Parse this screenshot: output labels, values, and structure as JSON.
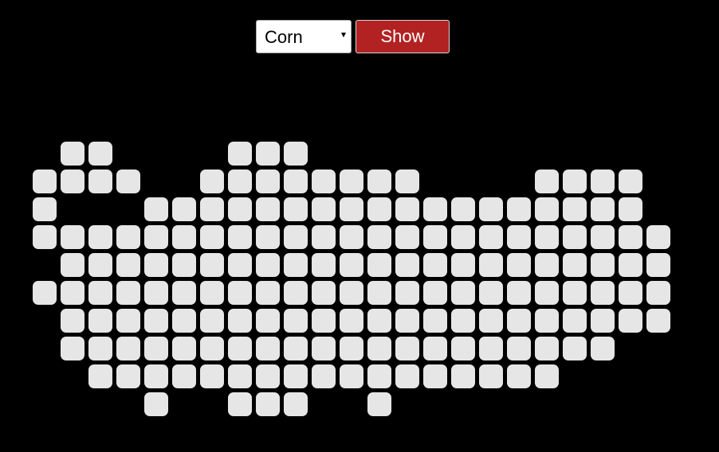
{
  "controls": {
    "crop_select": {
      "selected": "Corn"
    },
    "show_label": "Show"
  },
  "colors": {
    "background": "#000000",
    "tile": "#e6e6e6",
    "button": "#b22222"
  },
  "tile_map": {
    "rows": [
      [
        1,
        2,
        7,
        8,
        9
      ],
      [
        0,
        1,
        2,
        3,
        6,
        7,
        8,
        9,
        10,
        11,
        12,
        13,
        18,
        19,
        20,
        21
      ],
      [
        0,
        4,
        5,
        6,
        7,
        8,
        9,
        10,
        11,
        12,
        13,
        14,
        15,
        16,
        17,
        18,
        19,
        20,
        21
      ],
      [
        0,
        1,
        2,
        3,
        4,
        5,
        6,
        7,
        8,
        9,
        10,
        11,
        12,
        13,
        14,
        15,
        16,
        17,
        18,
        19,
        20,
        21,
        22
      ],
      [
        1,
        2,
        3,
        4,
        5,
        6,
        7,
        8,
        9,
        10,
        11,
        12,
        13,
        14,
        15,
        16,
        17,
        18,
        19,
        20,
        21,
        22
      ],
      [
        0,
        1,
        2,
        3,
        4,
        5,
        6,
        7,
        8,
        9,
        10,
        11,
        12,
        13,
        14,
        15,
        16,
        17,
        18,
        19,
        20,
        21,
        22
      ],
      [
        1,
        2,
        3,
        4,
        5,
        6,
        7,
        8,
        9,
        10,
        11,
        12,
        13,
        14,
        15,
        16,
        17,
        18,
        19,
        20,
        21,
        22
      ],
      [
        1,
        2,
        3,
        4,
        5,
        6,
        7,
        8,
        9,
        10,
        11,
        12,
        13,
        14,
        15,
        16,
        17,
        18,
        19,
        20
      ],
      [
        2,
        3,
        4,
        5,
        6,
        7,
        8,
        9,
        10,
        11,
        12,
        13,
        14,
        15,
        16,
        17,
        18
      ],
      [
        4,
        7,
        8,
        9,
        12
      ]
    ]
  }
}
